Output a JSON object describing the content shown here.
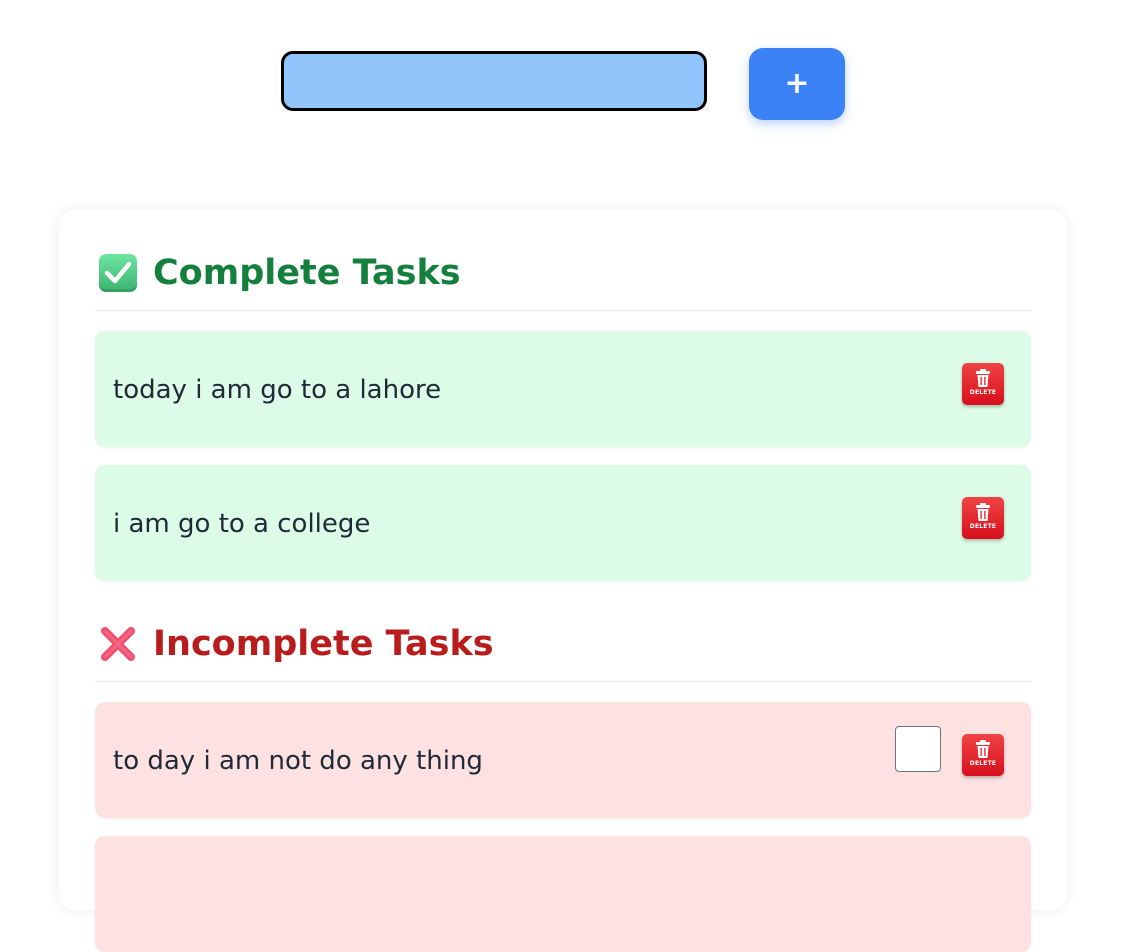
{
  "input": {
    "value": "",
    "placeholder": ""
  },
  "add_button": {
    "label": "+"
  },
  "sections": {
    "complete": {
      "title": "Complete Tasks",
      "icon": "check-mark-emoji-icon",
      "color": "#15803d",
      "tasks": [
        {
          "text": "today i am go to a lahore"
        },
        {
          "text": "i am go to a college"
        }
      ]
    },
    "incomplete": {
      "title": "Incomplete Tasks",
      "icon": "cross-mark-emoji-icon",
      "color": "#b91c1c",
      "tasks": [
        {
          "text": "to day i am not do any thing",
          "checked": false
        },
        {
          "text": ""
        }
      ]
    }
  },
  "delete_button": {
    "label": "DELETE",
    "icon": "trash-icon"
  },
  "colors": {
    "accent": "#3b82f6",
    "input_bg": "#93c5fd",
    "complete_bg": "#dcfce7",
    "incomplete_bg": "#fee2e2",
    "delete_red": "#dc2626"
  }
}
